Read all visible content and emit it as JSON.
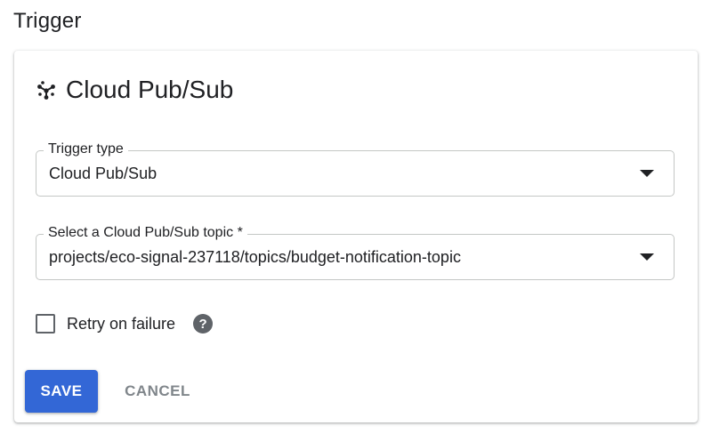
{
  "section": {
    "title": "Trigger"
  },
  "card": {
    "title": "Cloud Pub/Sub",
    "icon": "pubsub-icon"
  },
  "trigger_type": {
    "label": "Trigger type",
    "value": "Cloud Pub/Sub"
  },
  "topic": {
    "label": "Select a Cloud Pub/Sub topic *",
    "value": "projects/eco-signal-237118/topics/budget-notification-topic"
  },
  "retry": {
    "label": "Retry on failure",
    "checked": false,
    "help_icon": "help-circle-icon",
    "help_glyph": "?"
  },
  "actions": {
    "save_label": "SAVE",
    "cancel_label": "CANCEL"
  },
  "colors": {
    "primary": "#3367d6",
    "disabled_text": "#80868b",
    "border": "#c4c7c5",
    "icon_gray": "#5f6368"
  }
}
